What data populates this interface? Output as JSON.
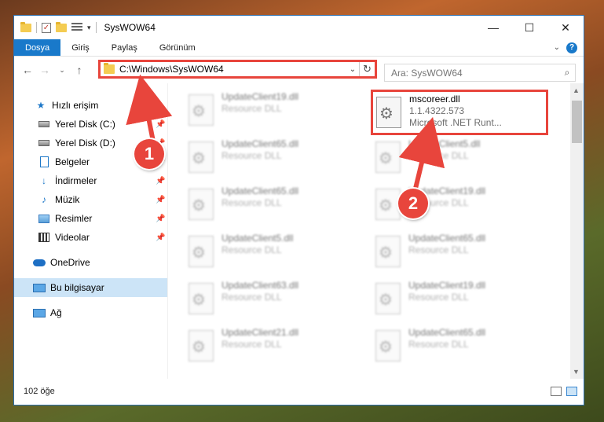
{
  "window": {
    "title": "SysWOW64",
    "controls": {
      "minimize": "—",
      "maximize": "☐",
      "close": "✕"
    }
  },
  "ribbon": {
    "tabs": [
      "Dosya",
      "Giriş",
      "Paylaş",
      "Görünüm"
    ]
  },
  "address": {
    "path": "C:\\Windows\\SysWOW64"
  },
  "search": {
    "placeholder": "Ara: SysWOW64"
  },
  "sidebar": {
    "items": [
      {
        "label": "Hızlı erişim",
        "icon": "star-icon"
      },
      {
        "label": "Yerel Disk (C:)",
        "icon": "disk-icon",
        "pinned": true
      },
      {
        "label": "Yerel Disk (D:)",
        "icon": "disk-icon",
        "pinned": true
      },
      {
        "label": "Belgeler",
        "icon": "document-icon",
        "pinned": true
      },
      {
        "label": "İndirmeler",
        "icon": "download-icon",
        "pinned": true
      },
      {
        "label": "Müzik",
        "icon": "music-icon",
        "pinned": true
      },
      {
        "label": "Resimler",
        "icon": "picture-icon",
        "pinned": true
      },
      {
        "label": "Videolar",
        "icon": "video-icon",
        "pinned": true
      },
      {
        "label": "OneDrive",
        "icon": "cloud-icon"
      },
      {
        "label": "Bu bilgisayar",
        "icon": "computer-icon",
        "selected": true
      },
      {
        "label": "Ağ",
        "icon": "network-icon"
      }
    ]
  },
  "files": {
    "left": [
      {
        "name": "UpdateClient19.dll",
        "type": "Resource DLL"
      },
      {
        "name": "UpdateClient65.dll",
        "type": "Resource DLL"
      },
      {
        "name": "UpdateClient65.dll",
        "type": "Resource DLL"
      },
      {
        "name": "UpdateClient5.dll",
        "type": "Resource DLL"
      },
      {
        "name": "UpdateClient63.dll",
        "type": "Resource DLL"
      },
      {
        "name": "UpdateClient21.dll",
        "type": "Resource DLL"
      }
    ],
    "focused": {
      "name": "mscoreer.dll",
      "version": "1.1.4322.573",
      "description": "Microsoft .NET Runt..."
    },
    "right": [
      {
        "name": "UpdateClient5.dll",
        "type": "Resource DLL"
      },
      {
        "name": "UpdateClient19.dll",
        "type": "Resource DLL"
      },
      {
        "name": "UpdateClient65.dll",
        "type": "Resource DLL"
      },
      {
        "name": "UpdateClient19.dll",
        "type": "Resource DLL"
      },
      {
        "name": "UpdateClient65.dll",
        "type": "Resource DLL"
      }
    ]
  },
  "status": {
    "count": "102 öğe"
  },
  "annotations": {
    "badge1": "1",
    "badge2": "2",
    "color": "#e8453c"
  }
}
